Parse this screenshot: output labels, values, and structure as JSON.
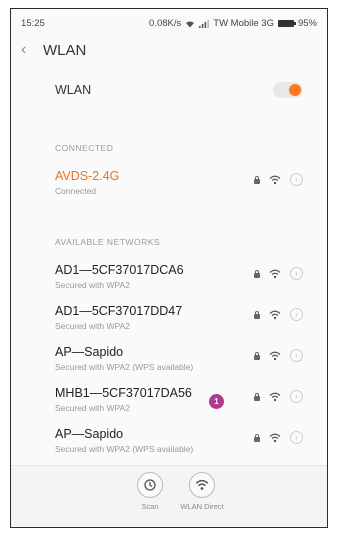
{
  "status_bar": {
    "time": "15:25",
    "speed": "0.08K/s",
    "carrier": "TW Mobile 3G",
    "battery": "95%"
  },
  "header": {
    "title": "WLAN"
  },
  "wlan_toggle": {
    "label": "WLAN",
    "on": true
  },
  "connected": {
    "section_label": "CONNECTED",
    "network": {
      "name": "AVDS-2.4G",
      "status": "Connected"
    }
  },
  "available": {
    "section_label": "AVAILABLE NETWORKS",
    "networks": [
      {
        "name": "AD1—5CF37017DCA6",
        "security": "Secured with WPA2"
      },
      {
        "name": "AD1—5CF37017DD47",
        "security": "Secured with WPA2"
      },
      {
        "name": "AP—Sapido",
        "security": "Secured with WPA2 (WPS available)"
      },
      {
        "name": "MHB1—5CF37017DA56",
        "security": "Secured with WPA2",
        "badge": "1"
      },
      {
        "name": "AP—Sapido",
        "security": "Secured with WPA2 (WPS available)"
      }
    ]
  },
  "bottom_bar": {
    "scan_label": "Scan",
    "direct_label": "WLAN Direct"
  },
  "colors": {
    "accent": "#ff7a1a",
    "badge": "#b03a8f"
  }
}
